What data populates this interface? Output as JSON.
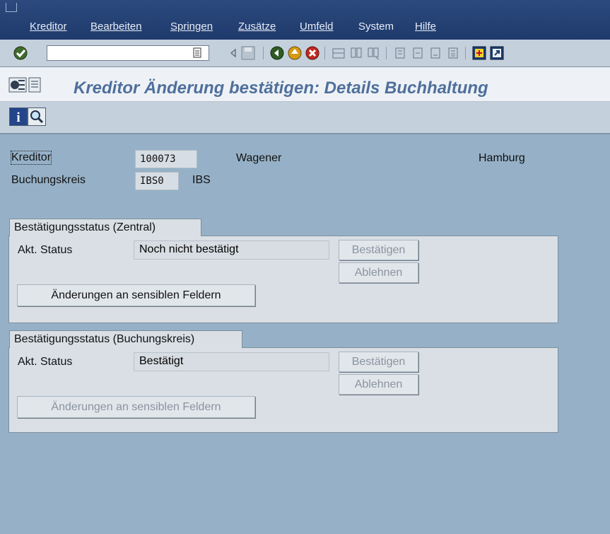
{
  "menu": {
    "items": [
      {
        "label": "Kreditor"
      },
      {
        "label": "Bearbeiten"
      },
      {
        "label": "Springen"
      },
      {
        "label": "Zusätze"
      },
      {
        "label": "Umfeld"
      },
      {
        "label": "System"
      },
      {
        "label": "Hilfe"
      }
    ]
  },
  "toolbar": {
    "command_field_value": "",
    "icons": [
      "enter-icon",
      "history-icon",
      "back-triangle-icon",
      "save-icon",
      "back-icon",
      "exit-icon",
      "cancel-icon",
      "print-icon",
      "find-icon",
      "find-next-icon",
      "first-page-icon",
      "previous-page-icon",
      "next-page-icon",
      "last-page-icon",
      "new-session-icon",
      "shortcut-icon"
    ]
  },
  "title": {
    "text": "Kreditor Änderung bestätigen: Details Buchhaltung"
  },
  "header": {
    "kreditor_label": "Kreditor",
    "kreditor_value": "100073",
    "kreditor_name": "Wagener",
    "kreditor_city": "Hamburg",
    "bukrs_label": "Buchungskreis",
    "bukrs_value": "IBS0",
    "bukrs_name": "IBS"
  },
  "group_central": {
    "title": "Bestätigungsstatus (Zentral)",
    "status_label": "Akt. Status",
    "status_value": "Noch nicht bestätigt",
    "confirm_label": "Bestätigen",
    "reject_label": "Ablehnen",
    "changes_label": "Änderungen an sensiblen Feldern"
  },
  "group_company": {
    "title": "Bestätigungsstatus (Buchungskreis)",
    "status_label": "Akt. Status",
    "status_value": "Bestätigt",
    "confirm_label": "Bestätigen",
    "reject_label": "Ablehnen",
    "changes_label": "Änderungen an sensiblen Feldern"
  },
  "colors": {
    "menubar": "#23406f",
    "title": "#4f6f9c",
    "background": "#96b1c7"
  }
}
